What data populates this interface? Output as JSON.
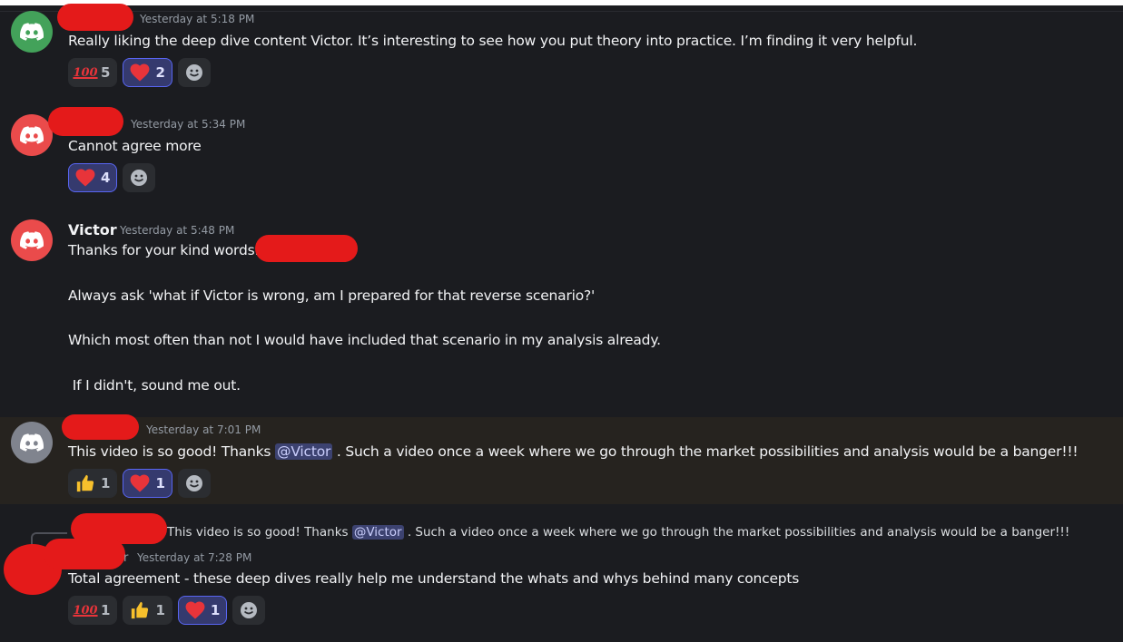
{
  "colors": {
    "avatar_green": "#43a25a",
    "avatar_red": "#ea4b4b",
    "avatar_gray": "#80848e",
    "mention_bg": "#3c4270",
    "redaction": "#e41a1a"
  },
  "messages": [
    {
      "timestamp": "Yesterday at 5:18 PM",
      "text": "Really liking the deep dive content Victor. It’s interesting to see how you put theory into practice. I’m finding it very helpful.",
      "reactions": [
        {
          "emoji": "hundred-points-icon",
          "count": "5"
        },
        {
          "emoji": "red-heart-icon",
          "count": "2",
          "active": true
        }
      ]
    },
    {
      "timestamp": "Yesterday at 5:34 PM",
      "text": "Cannot agree more",
      "reactions": [
        {
          "emoji": "red-heart-icon",
          "count": "4",
          "active": true
        }
      ]
    },
    {
      "author": "Victor",
      "timestamp": "Yesterday at 5:48 PM",
      "lines": [
        "Thanks for your kind words.",
        "Always ask 'what if Victor is wrong, am I prepared for that reverse scenario?'",
        "Which most often than not I would have included that scenario in my analysis already.",
        " If I didn't, sound me out."
      ]
    },
    {
      "timestamp": "Yesterday at 7:01 PM",
      "text_before": "This video is so good! Thanks ",
      "mention": "@Victor",
      "text_after": " . Such a video once a week where we go through the market possibilities and analysis would be a banger!!!",
      "reactions": [
        {
          "emoji": "thumbs-up-icon",
          "count": "1"
        },
        {
          "emoji": "red-heart-icon",
          "count": "1",
          "active": true
        }
      ]
    },
    {
      "reply": {
        "text_before": "This video is so good! Thanks ",
        "mention": "@Victor",
        "text_after": " . Such a video once a week where we go through the market possibilities and analysis would be a banger!!!"
      },
      "author_partial": "r",
      "timestamp": "Yesterday at 7:28 PM",
      "text": "Total agreement - these deep dives really help me understand the whats and whys behind many concepts",
      "reactions": [
        {
          "emoji": "hundred-points-icon",
          "count": "1"
        },
        {
          "emoji": "thumbs-up-icon",
          "count": "1"
        },
        {
          "emoji": "red-heart-icon",
          "count": "1",
          "active": true
        }
      ]
    }
  ]
}
